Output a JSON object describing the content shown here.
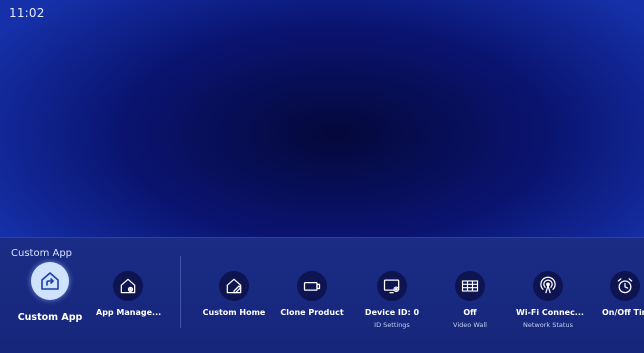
{
  "status": {
    "time": "11:02"
  },
  "section": {
    "title": "Custom App"
  },
  "items": [
    {
      "label": "Custom App",
      "sub": "",
      "icon": "custom-app-icon",
      "selected": true
    },
    {
      "label": "App Manage...",
      "sub": "",
      "icon": "app-manager-icon"
    },
    {
      "label": "Custom Home",
      "sub": "",
      "icon": "custom-home-icon"
    },
    {
      "label": "Clone Product",
      "sub": "",
      "icon": "usb-clone-icon"
    },
    {
      "label": "Device ID: 0",
      "sub": "ID Settings",
      "icon": "device-settings-icon"
    },
    {
      "label": "Off",
      "sub": "Video Wall",
      "icon": "video-wall-grid-icon"
    },
    {
      "label": "Wi-Fi Connec...",
      "sub": "Network Status",
      "icon": "wifi-antenna-icon"
    },
    {
      "label": "On/Off Tin",
      "sub": "",
      "icon": "alarm-clock-icon"
    }
  ],
  "colors": {
    "background": "#0a1470",
    "panel": "#1b2c86",
    "selected_icon_bg": "#cfe3ff"
  }
}
